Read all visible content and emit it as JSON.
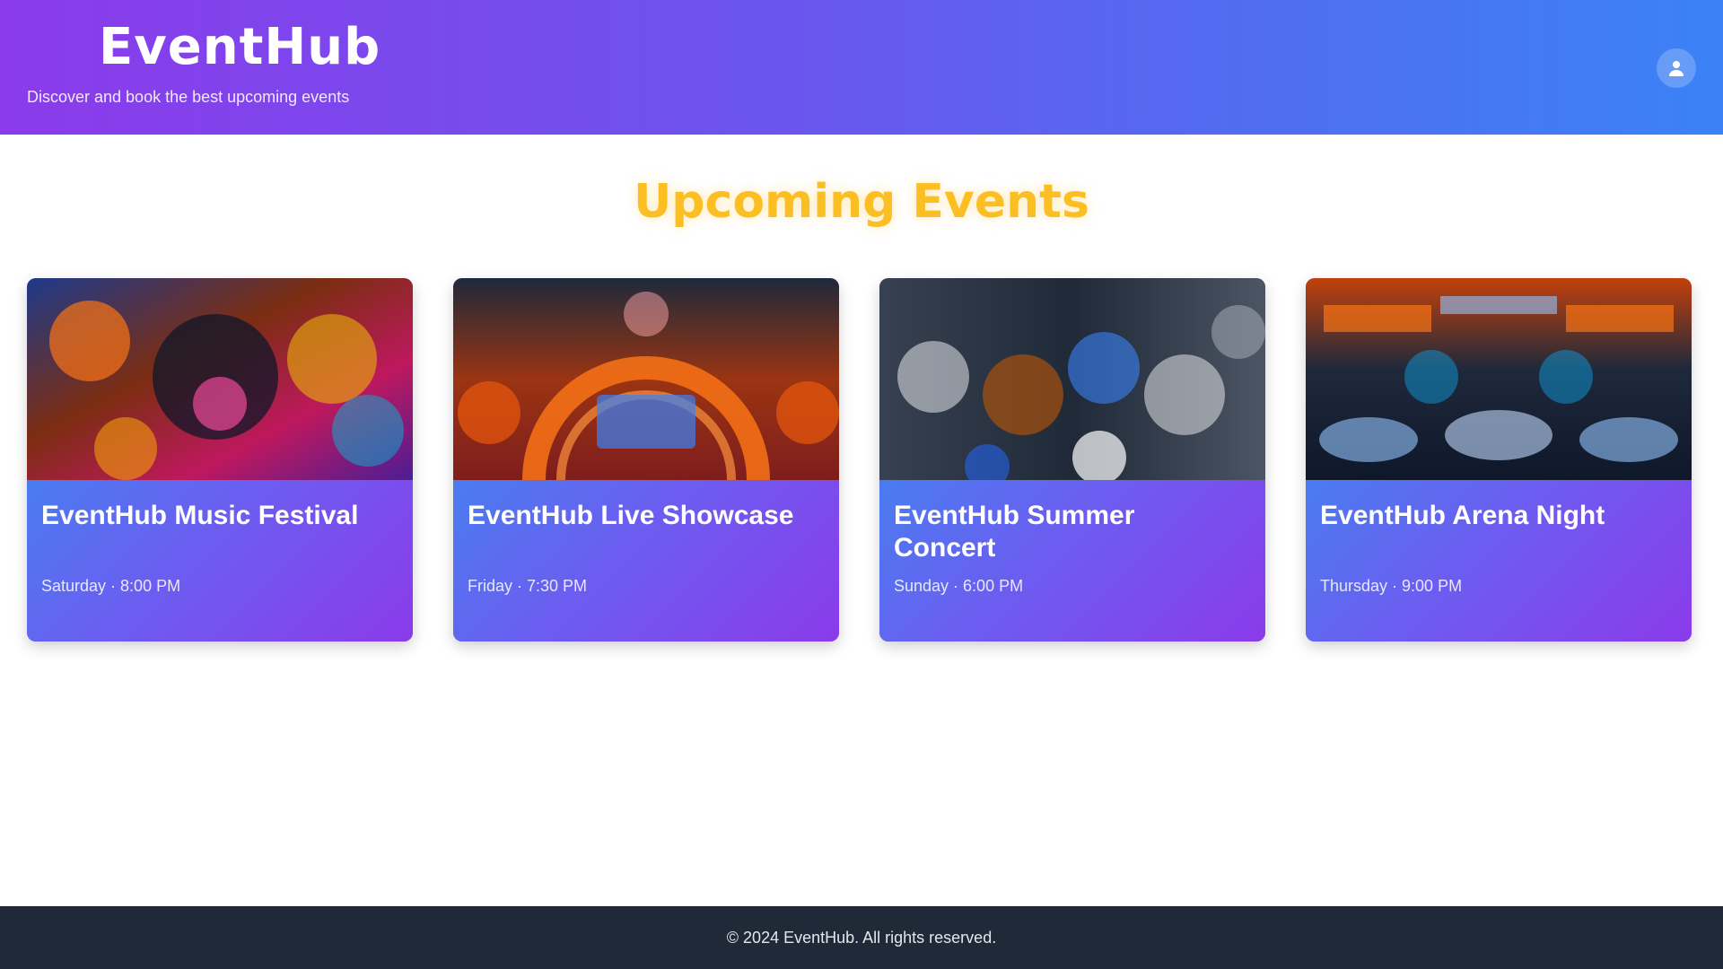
{
  "header": {
    "brand": "EventHub",
    "tagline": "Discover and book the best upcoming events",
    "user_icon": "user-icon"
  },
  "main": {
    "section_title": "Upcoming Events"
  },
  "events": [
    {
      "title": "EventHub Music Festival",
      "meta": "Saturday · 8:00 PM",
      "image": "concert-crowd"
    },
    {
      "title": "EventHub Live Showcase",
      "meta": "Friday · 7:30 PM",
      "image": "stage-arch"
    },
    {
      "title": "EventHub Summer Concert",
      "meta": "Sunday · 6:00 PM",
      "image": "audience-hall"
    },
    {
      "title": "EventHub Arena Night",
      "meta": "Thursday · 9:00 PM",
      "image": "arena-lights"
    }
  ],
  "footer": {
    "text": "© 2024 EventHub. All rights reserved."
  },
  "colors": {
    "header_start": "#8b3bea",
    "header_end": "#3b82f6",
    "section_title": "#fbbf24",
    "footer_bg": "#1f2937"
  }
}
